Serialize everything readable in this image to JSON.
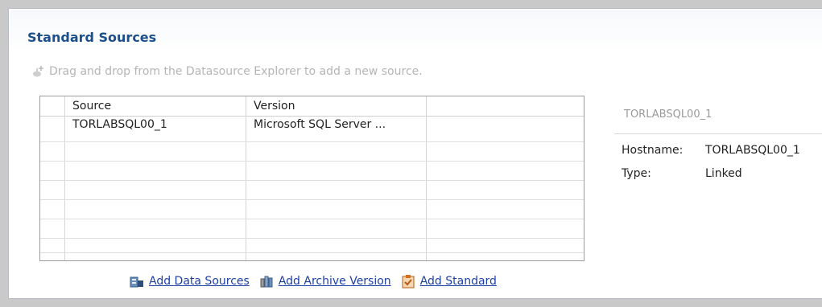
{
  "section": {
    "title": "Standard Sources",
    "hint": "Drag and drop from the Datasource Explorer to add a new source."
  },
  "table": {
    "columns": [
      "Source",
      "Version",
      ""
    ],
    "rows": [
      {
        "source": "TORLABSQL00_1",
        "version": "Microsoft SQL Server ..."
      }
    ]
  },
  "detail": {
    "title": "TORLABSQL00_1",
    "fields": [
      {
        "label": "Hostname:",
        "value": "TORLABSQL00_1"
      },
      {
        "label": "Type:",
        "value": "Linked"
      }
    ]
  },
  "actions": [
    {
      "label": "Add Data Sources",
      "icon": "add-data-sources-icon"
    },
    {
      "label": "Add Archive Version",
      "icon": "add-archive-version-icon"
    },
    {
      "label": "Add Standard",
      "icon": "add-standard-icon"
    }
  ],
  "colors": {
    "title": "#1c4f8b",
    "link": "#1d3fa8",
    "hint": "#b5b5b5"
  }
}
